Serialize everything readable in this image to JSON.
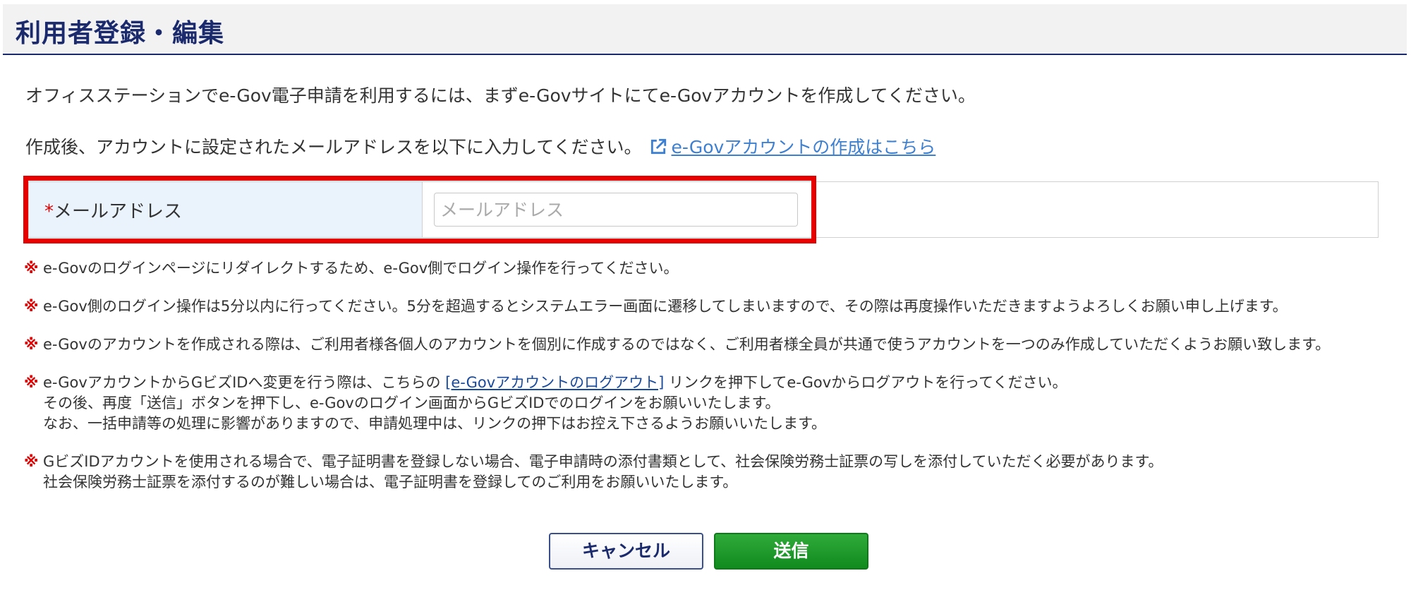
{
  "header": {
    "title": "利用者登録・編集"
  },
  "intro": {
    "line1": "オフィスステーションでe-Gov電子申請を利用するには、まずe-Govサイトにてe-Govアカウントを作成してください。",
    "line2": "作成後、アカウントに設定されたメールアドレスを以下に入力してください。",
    "link_label": "e-Govアカウントの作成はこちら",
    "link_icon": "external-link-icon"
  },
  "form": {
    "required_mark": "*",
    "email_label": "メールアドレス",
    "email_value": "",
    "email_placeholder": "メールアドレス"
  },
  "notes": {
    "mark": "※",
    "n1": "e-Govのログインページにリダイレクトするため、e-Gov側でログイン操作を行ってください。",
    "n2": "e-Gov側のログイン操作は5分以内に行ってください。5分を超過するとシステムエラー画面に遷移してしまいますので、その際は再度操作いただきますようよろしくお願い申し上げます。",
    "n3": "e-Govのアカウントを作成される際は、ご利用者様各個人のアカウントを個別に作成するのではなく、ご利用者様全員が共通で使うアカウントを一つのみ作成していただくようお願い致します。",
    "n4_before": "e-GovアカウントからGビズIDへ変更を行う際は、こちらの ",
    "n4_link": "[e-Govアカウントのログアウト]",
    "n4_after": " リンクを押下してe-Govからログアウトを行ってください。",
    "n4_line2": "その後、再度「送信」ボタンを押下し、e-Govのログイン画面からGビズIDでのログインをお願いいたします。",
    "n4_line3": "なお、一括申請等の処理に影響がありますので、申請処理中は、リンクの押下はお控え下さるようお願いいたします。",
    "n5_line1": "GビズIDアカウントを使用される場合で、電子証明書を登録しない場合、電子申請時の添付書類として、社会保険労務士証票の写しを添付していただく必要があります。",
    "n5_line2": "社会保険労務士証票を添付するのが難しい場合は、電子証明書を登録してのご利用をお願いいたします。"
  },
  "buttons": {
    "cancel_label": "キャンセル",
    "submit_label": "送信"
  },
  "colors": {
    "header_text": "#1a2a6c",
    "highlight": "#e60000",
    "submit": "#1a9a2a",
    "link": "#3d7fd1"
  }
}
